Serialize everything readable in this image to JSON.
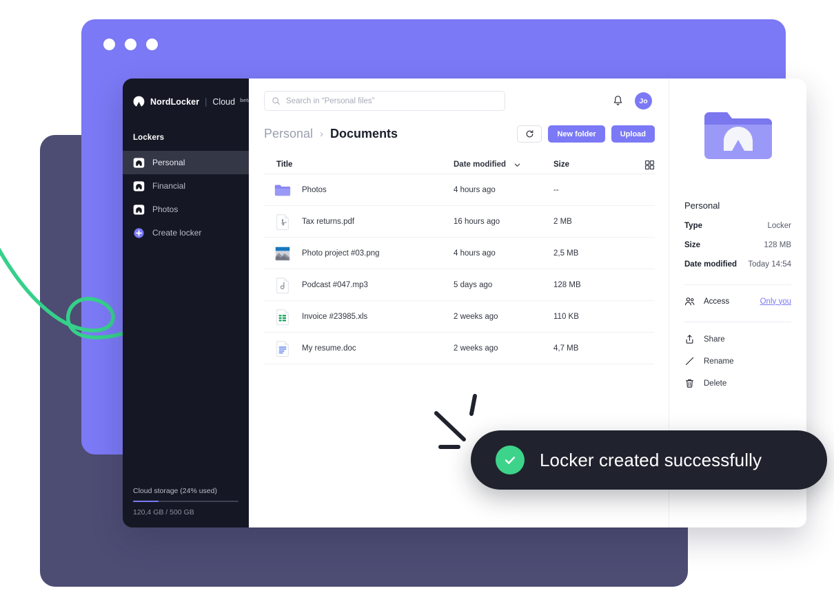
{
  "window": {
    "traffic_lights": [
      "close",
      "minimize",
      "maximize"
    ]
  },
  "sidebar": {
    "brand": {
      "name": "NordLocker",
      "separator": "|",
      "product": "Cloud",
      "badge": "beta",
      "logo_icon": "nordlocker-mountain-icon"
    },
    "section_title": "Lockers",
    "items": [
      {
        "label": "Personal",
        "icon": "locker-icon",
        "active": true
      },
      {
        "label": "Financial",
        "icon": "locker-icon",
        "active": false
      },
      {
        "label": "Photos",
        "icon": "locker-icon",
        "active": false
      },
      {
        "label": "Create locker",
        "icon": "plus-circle-icon",
        "active": false
      }
    ],
    "storage": {
      "label": "Cloud storage (24% used)",
      "percent": 24,
      "detail": "120,4 GB / 500 GB"
    }
  },
  "search": {
    "placeholder": "Search in “Personal files”",
    "value": "",
    "icon": "search-icon"
  },
  "topbar": {
    "bell_icon": "bell-icon",
    "avatar_initials": "Jo"
  },
  "breadcrumb": {
    "parent": "Personal",
    "separator": "›",
    "current": "Documents"
  },
  "actions": {
    "refresh_icon": "refresh-icon",
    "new_folder_label": "New folder",
    "upload_label": "Upload"
  },
  "table": {
    "columns": {
      "title": "Title",
      "date_modified": "Date modified",
      "size": "Size",
      "sort_icon": "chevron-down-icon",
      "view_icon": "grid-view-icon"
    },
    "rows": [
      {
        "name": "Photos",
        "date": "4 hours ago",
        "size": "--",
        "icon": "folder-icon"
      },
      {
        "name": "Tax returns.pdf",
        "date": "16 hours ago",
        "size": "2 MB",
        "icon": "pdf-file-icon"
      },
      {
        "name": "Photo project #03.png",
        "date": "4 hours ago",
        "size": "2,5 MB",
        "icon": "image-file-icon"
      },
      {
        "name": "Podcast #047.mp3",
        "date": "5 days ago",
        "size": "128 MB",
        "icon": "audio-file-icon"
      },
      {
        "name": "Invoice #23985.xls",
        "date": "2 weeks ago",
        "size": "110 KB",
        "icon": "spreadsheet-file-icon"
      },
      {
        "name": "My resume.doc",
        "date": "2 weeks ago",
        "size": "4,7 MB",
        "icon": "document-file-icon"
      }
    ]
  },
  "detail": {
    "thumb_icon": "locker-folder-icon",
    "name": "Personal",
    "properties": [
      {
        "key": "Type",
        "value": "Locker"
      },
      {
        "key": "Size",
        "value": "128 MB"
      },
      {
        "key": "Date modified",
        "value": "Today 14:54"
      }
    ],
    "access": {
      "icon": "people-icon",
      "label": "Access",
      "value": "Only you"
    },
    "actions": [
      {
        "label": "Share",
        "icon": "share-icon"
      },
      {
        "label": "Rename",
        "icon": "pencil-icon"
      },
      {
        "label": "Delete",
        "icon": "trash-icon"
      }
    ]
  },
  "toast": {
    "icon": "check-circle-icon",
    "message": "Locker created successfully"
  },
  "decorations": {
    "arrow_icon": "curly-arrow-icon",
    "burst_icon": "burst-lines-icon"
  },
  "colors": {
    "accent_purple": "#7b79f5",
    "window_mid": "#7b79f5",
    "window_back": "#4d4c73",
    "sidebar_dark": "#151824",
    "toast_dark": "#20232e",
    "success_green": "#3ed38a",
    "arrow_green": "#35d08a"
  }
}
